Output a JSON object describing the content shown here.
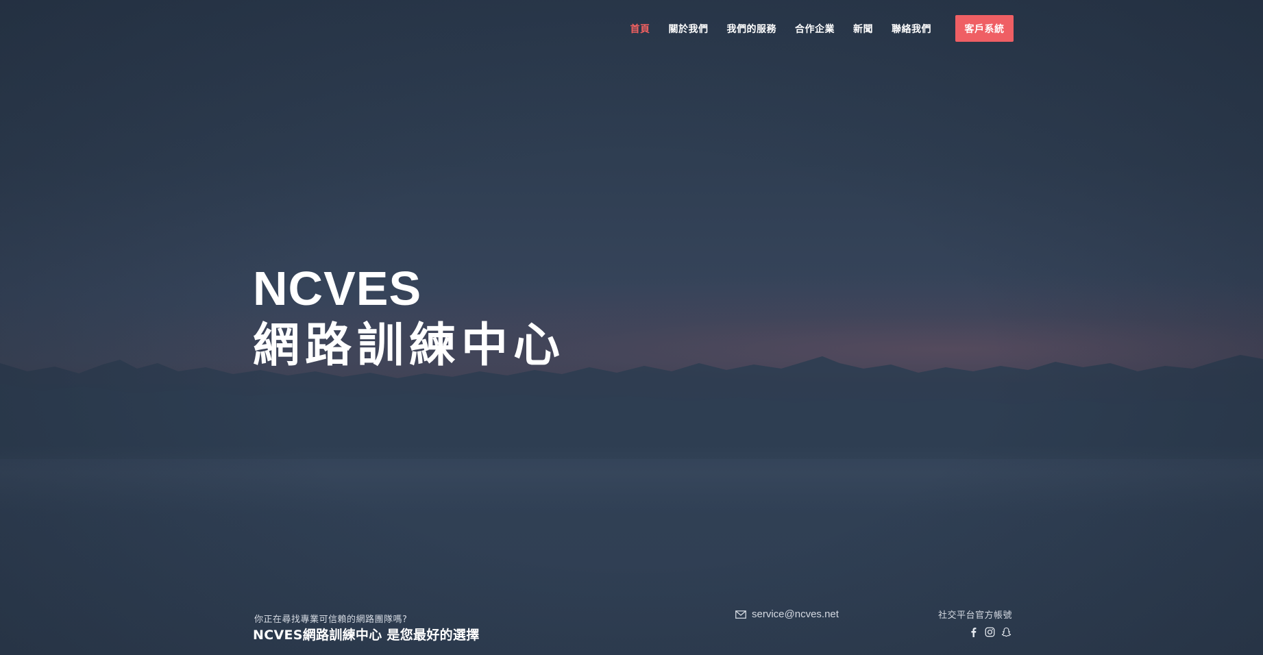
{
  "nav": {
    "items": [
      {
        "label": "首頁",
        "active": true
      },
      {
        "label": "關於我們",
        "active": false
      },
      {
        "label": "我們的服務",
        "active": false
      },
      {
        "label": "合作企業",
        "active": false
      },
      {
        "label": "新聞",
        "active": false
      },
      {
        "label": "聯絡我們",
        "active": false
      }
    ],
    "cta_label": "客戶系統"
  },
  "hero": {
    "title_line1": "NCVES",
    "title_line2": "網路訓練中心"
  },
  "footer": {
    "tagline": "你正在尋找專業可信賴的網路團隊嗎?",
    "headline": "NCVES網路訓練中心 是您最好的選擇",
    "email": "service@ncves.net",
    "email_icon": "envelope-icon",
    "social_label": "社交平台官方帳號",
    "social_icons": [
      "facebook-icon",
      "instagram-icon",
      "snapchat-icon"
    ]
  },
  "colors": {
    "accent": "#ef5f64",
    "active_nav": "#f06060",
    "background": "#314052",
    "text": "#ffffff"
  }
}
